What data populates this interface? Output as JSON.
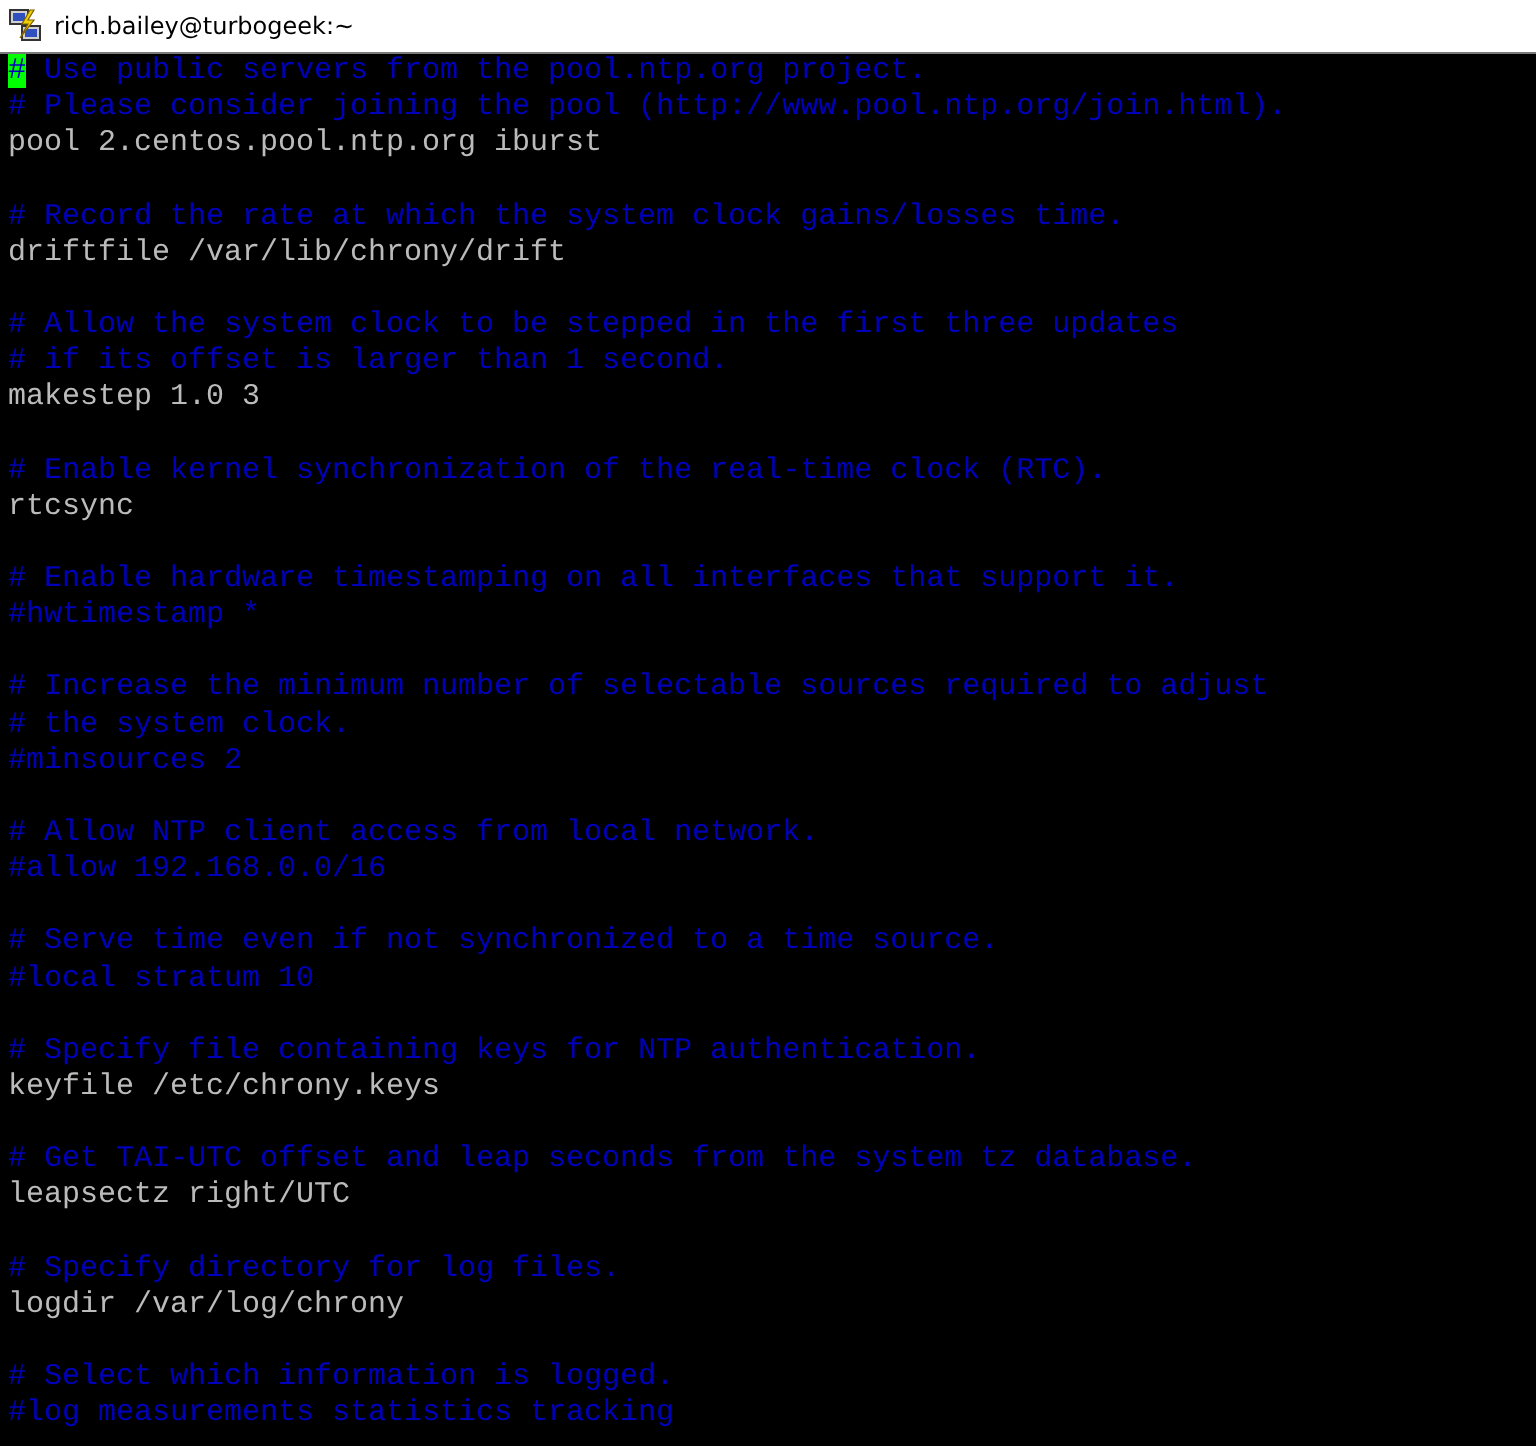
{
  "window": {
    "title": "rich.bailey@turbogeek:~"
  },
  "lines": [
    {
      "kind": "comment",
      "text": "# Use public servers from the pool.ntp.org project.",
      "cursor": true
    },
    {
      "kind": "comment",
      "text": "# Please consider joining the pool (http://www.pool.ntp.org/join.html).",
      "cursor": false
    },
    {
      "kind": "setting",
      "text": "pool 2.centos.pool.ntp.org iburst",
      "cursor": false
    },
    {
      "kind": "blank",
      "cursor": false
    },
    {
      "kind": "comment",
      "text": "# Record the rate at which the system clock gains/losses time.",
      "cursor": false
    },
    {
      "kind": "setting",
      "text": "driftfile /var/lib/chrony/drift",
      "cursor": false
    },
    {
      "kind": "blank",
      "cursor": false
    },
    {
      "kind": "comment",
      "text": "# Allow the system clock to be stepped in the first three updates",
      "cursor": false
    },
    {
      "kind": "comment",
      "text": "# if its offset is larger than 1 second.",
      "cursor": false
    },
    {
      "kind": "setting",
      "text": "makestep 1.0 3",
      "cursor": false
    },
    {
      "kind": "blank",
      "cursor": false
    },
    {
      "kind": "comment",
      "text": "# Enable kernel synchronization of the real-time clock (RTC).",
      "cursor": false
    },
    {
      "kind": "setting",
      "text": "rtcsync",
      "cursor": false
    },
    {
      "kind": "blank",
      "cursor": false
    },
    {
      "kind": "comment",
      "text": "# Enable hardware timestamping on all interfaces that support it.",
      "cursor": false
    },
    {
      "kind": "comment",
      "text": "#hwtimestamp *",
      "cursor": false
    },
    {
      "kind": "blank",
      "cursor": false
    },
    {
      "kind": "comment",
      "text": "# Increase the minimum number of selectable sources required to adjust",
      "cursor": false
    },
    {
      "kind": "comment",
      "text": "# the system clock.",
      "cursor": false
    },
    {
      "kind": "comment",
      "text": "#minsources 2",
      "cursor": false
    },
    {
      "kind": "blank",
      "cursor": false
    },
    {
      "kind": "comment",
      "text": "# Allow NTP client access from local network.",
      "cursor": false
    },
    {
      "kind": "comment",
      "text": "#allow 192.168.0.0/16",
      "cursor": false
    },
    {
      "kind": "blank",
      "cursor": false
    },
    {
      "kind": "comment",
      "text": "# Serve time even if not synchronized to a time source.",
      "cursor": false
    },
    {
      "kind": "comment",
      "text": "#local stratum 10",
      "cursor": false
    },
    {
      "kind": "blank",
      "cursor": false
    },
    {
      "kind": "comment",
      "text": "# Specify file containing keys for NTP authentication.",
      "cursor": false
    },
    {
      "kind": "setting",
      "text": "keyfile /etc/chrony.keys",
      "cursor": false
    },
    {
      "kind": "blank",
      "cursor": false
    },
    {
      "kind": "comment",
      "text": "# Get TAI-UTC offset and leap seconds from the system tz database.",
      "cursor": false
    },
    {
      "kind": "setting",
      "text": "leapsectz right/UTC",
      "cursor": false
    },
    {
      "kind": "blank",
      "cursor": false
    },
    {
      "kind": "comment",
      "text": "# Specify directory for log files.",
      "cursor": false
    },
    {
      "kind": "setting",
      "text": "logdir /var/log/chrony",
      "cursor": false
    },
    {
      "kind": "blank",
      "cursor": false
    },
    {
      "kind": "comment",
      "text": "# Select which information is logged.",
      "cursor": false
    },
    {
      "kind": "comment",
      "text": "#log measurements statistics tracking",
      "cursor": false
    }
  ]
}
